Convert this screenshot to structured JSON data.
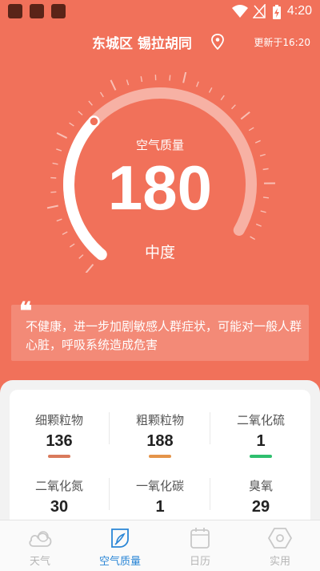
{
  "status_bar": {
    "time": "4:20"
  },
  "header": {
    "location": "东城区 锡拉胡同",
    "updated": "更新于16:20"
  },
  "gauge": {
    "label": "空气质量",
    "aqi": "180",
    "level": "中度",
    "progress_fraction": 0.36
  },
  "advice": {
    "quote": "❝",
    "text": "不健康，进一步加剧敏感人群症状，可能对一般人群心脏，呼吸系统造成危害"
  },
  "pollutants": [
    {
      "name": "细颗粒物",
      "value": "136",
      "color": "#d97a5c"
    },
    {
      "name": "粗颗粒物",
      "value": "188",
      "color": "#e4944a"
    },
    {
      "name": "二氧化硫",
      "value": "1",
      "color": "#2fbf6e"
    },
    {
      "name": "二氧化氮",
      "value": "30",
      "color": "#2fbf6e"
    },
    {
      "name": "一氧化碳",
      "value": "1",
      "color": "#2fbf6e"
    },
    {
      "name": "臭氧",
      "value": "29",
      "color": "#2fbf6e"
    }
  ],
  "tabs": [
    {
      "label": "天气",
      "icon": "cloud-icon",
      "active": false
    },
    {
      "label": "空气质量",
      "icon": "leaf-icon",
      "active": true
    },
    {
      "label": "日历",
      "icon": "calendar-icon",
      "active": false
    },
    {
      "label": "实用",
      "icon": "hexagon-icon",
      "active": false
    }
  ],
  "colors": {
    "background": "#F1715A",
    "active_tab": "#2a86d6",
    "inactive_tab": "#b5b5b5"
  }
}
